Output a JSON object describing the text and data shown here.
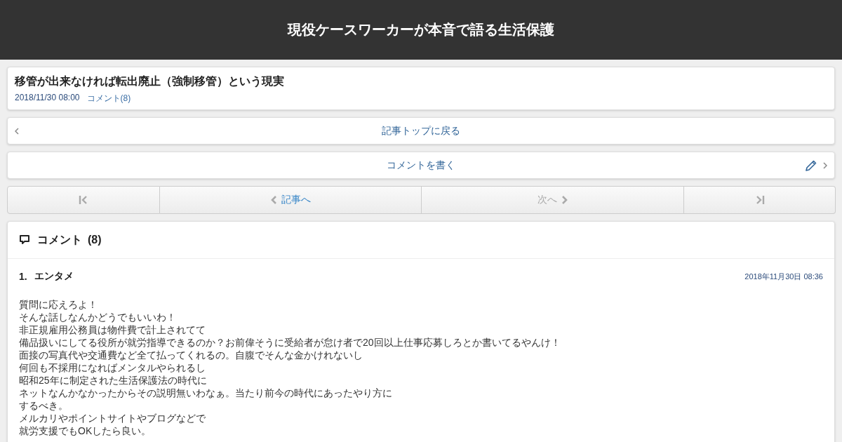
{
  "header": {
    "title": "現役ケースワーカーが本音で語る生活保護"
  },
  "article": {
    "title": "移管が出来なければ転出廃止（強制移管）という現実",
    "date": "2018/11/30 08:00",
    "comments_link": "コメント(8)"
  },
  "back_link": {
    "label": "記事トップに戻る"
  },
  "write_link": {
    "label": "コメントを書く"
  },
  "pager": [
    {
      "kind": "first",
      "disabled": true
    },
    {
      "kind": "prev",
      "label": "記事へ",
      "disabled": false
    },
    {
      "kind": "next",
      "label": "次へ",
      "disabled": true
    },
    {
      "kind": "last",
      "disabled": true
    }
  ],
  "comments_section": {
    "title": "コメント",
    "count": "(8)",
    "comments": [
      {
        "number": "1.",
        "author": "エンタメ",
        "date": "2018年11月30日 08:36",
        "lines": [
          "質問に応えろよ！",
          "そんな話しなんかどうでもいいわ！",
          "非正規雇用公務員は物件費で計上されてて",
          "備品扱いにしてる役所が就労指導できるのか？お前偉そうに受給者が怠け者で20回以上仕事応募しろとか書いてるやんけ！",
          "面接の写真代や交通費など全て払ってくれるの。自腹でそんな金かけれないし",
          "何回も不採用になればメンタルやられるし",
          "昭和25年に制定された生活保護法の時代に",
          "ネットなんかなかったからその説明無いわなぁ。当たり前今の時代にあったやり方に",
          "するべき。",
          "メルカリやポイントサイトやブログなどで",
          "就労支援でもOKしたら良い。"
        ]
      }
    ]
  }
}
